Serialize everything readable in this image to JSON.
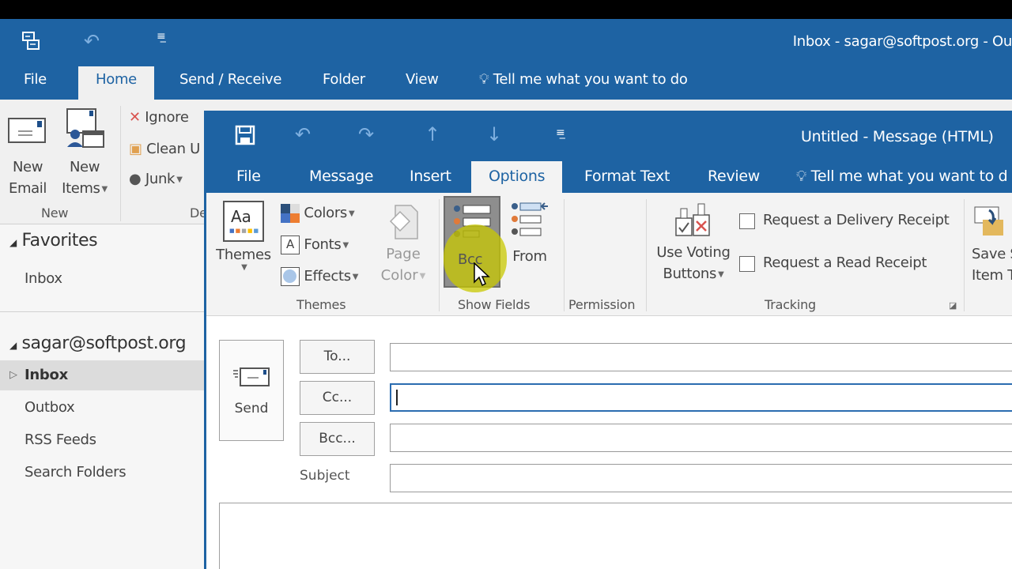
{
  "main_window": {
    "title": "Inbox - sagar@softpost.org - Ou",
    "qat": {
      "icons": [
        "send-receive-all-icon",
        "undo-icon",
        "customize-qat-icon"
      ]
    },
    "tabs": [
      {
        "label": "File",
        "active": false
      },
      {
        "label": "Home",
        "active": true
      },
      {
        "label": "Send / Receive",
        "active": false
      },
      {
        "label": "Folder",
        "active": false
      },
      {
        "label": "View",
        "active": false
      }
    ],
    "tell_me": "Tell me what you want to do",
    "ribbon": {
      "new_email": {
        "line1": "New",
        "line2": "Email"
      },
      "new_items": {
        "line1": "New",
        "line2": "Items"
      },
      "group_new": "New",
      "ignore": "Ignore",
      "clean_up": "Clean U",
      "junk": "Junk",
      "group_delete": "De"
    }
  },
  "nav_pane": {
    "favorites_header": "Favorites",
    "favorites": [
      {
        "label": "Inbox"
      }
    ],
    "account_header": "sagar@softpost.org",
    "folders": [
      {
        "label": "Inbox",
        "selected": true,
        "expandable": true
      },
      {
        "label": "Outbox",
        "selected": false
      },
      {
        "label": "RSS Feeds",
        "selected": false
      },
      {
        "label": "Search Folders",
        "selected": false
      }
    ]
  },
  "message_window": {
    "title": "Untitled - Message (HTML)",
    "qat": {
      "icons": [
        "save-icon",
        "undo-icon",
        "redo-icon",
        "previous-item-icon",
        "next-item-icon",
        "customize-qat-icon"
      ]
    },
    "tabs": [
      {
        "label": "File",
        "active": false
      },
      {
        "label": "Message",
        "active": false
      },
      {
        "label": "Insert",
        "active": false
      },
      {
        "label": "Options",
        "active": true
      },
      {
        "label": "Format Text",
        "active": false
      },
      {
        "label": "Review",
        "active": false
      }
    ],
    "tell_me": "Tell me what you want to d",
    "ribbon": {
      "themes": {
        "themes_btn": "Themes",
        "colors": "Colors",
        "fonts": "Fonts",
        "effects": "Effects",
        "page_color_line1": "Page",
        "page_color_line2": "Color",
        "group_label": "Themes"
      },
      "show_fields": {
        "bcc": "Bcc",
        "from": "From",
        "group_label": "Show Fields"
      },
      "permission": {
        "group_label": "Permission"
      },
      "tracking": {
        "voting_line1": "Use Voting",
        "voting_line2": "Buttons",
        "delivery_receipt": "Request a Delivery Receipt",
        "delivery_receipt_checked": false,
        "read_receipt": "Request a Read Receipt",
        "read_receipt_checked": false,
        "group_label": "Tracking"
      },
      "save_sent": {
        "line1": "Save S",
        "line2": "Item T"
      }
    },
    "compose": {
      "send": "Send",
      "to_btn": "To...",
      "cc_btn": "Cc...",
      "bcc_btn": "Bcc...",
      "subject_label": "Subject",
      "to_value": "",
      "cc_value": "",
      "bcc_value": "",
      "subject_value": "",
      "focused_field": "cc"
    }
  }
}
